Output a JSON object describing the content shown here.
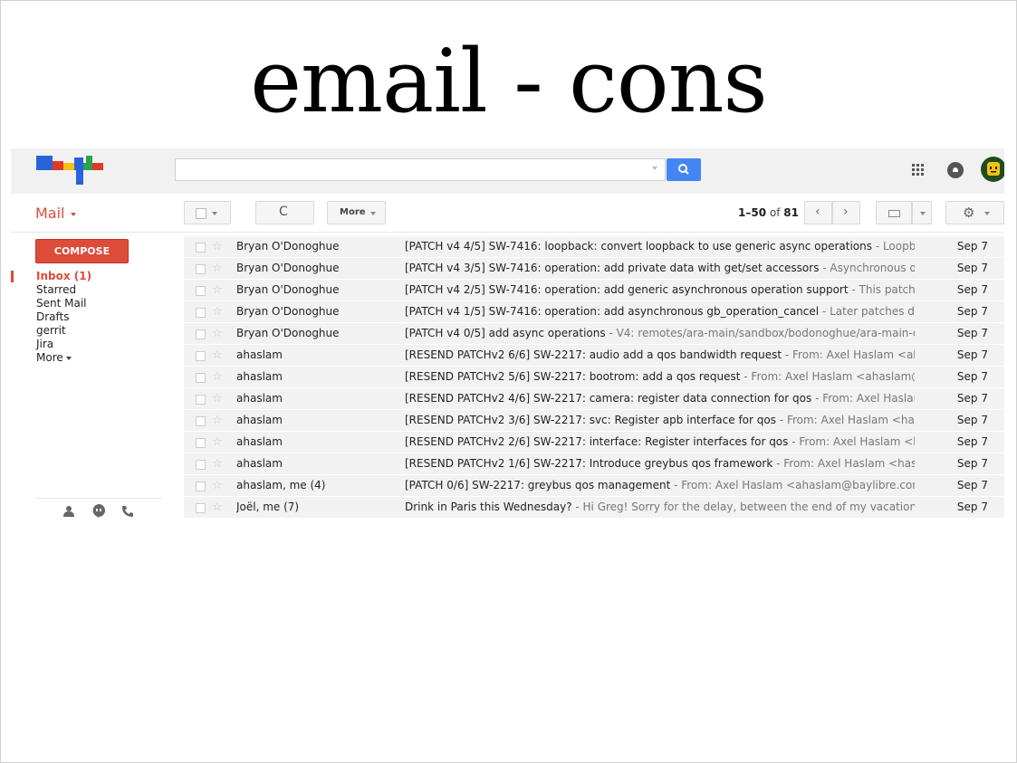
{
  "slide": {
    "title": "email - cons"
  },
  "header": {
    "search": {
      "value": "",
      "placeholder": ""
    }
  },
  "toolbar": {
    "mail_label": "Mail",
    "more_label": "More",
    "refresh_glyph": "C",
    "pager": {
      "range": "1–50",
      "of": " of ",
      "total": "81"
    }
  },
  "sidebar": {
    "compose_label": "COMPOSE",
    "items": [
      {
        "label": "Inbox (1)",
        "active": true
      },
      {
        "label": "Starred"
      },
      {
        "label": "Sent Mail"
      },
      {
        "label": "Drafts"
      },
      {
        "label": "gerrit"
      },
      {
        "label": "Jira"
      },
      {
        "label": "More"
      }
    ]
  },
  "emails": [
    {
      "sender": "Bryan O'Donoghue",
      "subject": "[PATCH v4 4/5] SW-7416: loopback: convert loopback to use generic async operations",
      "snippet": " - Loopbac",
      "date": "Sep 7"
    },
    {
      "sender": "Bryan O'Donoghue",
      "subject": "[PATCH v4 3/5] SW-7416: operation: add private data with get/set accessors",
      "snippet": " - Asynchronous ope",
      "date": "Sep 7"
    },
    {
      "sender": "Bryan O'Donoghue",
      "subject": "[PATCH v4 2/5] SW-7416: operation: add generic asynchronous operation support",
      "snippet": " - This patch ac",
      "date": "Sep 7"
    },
    {
      "sender": "Bryan O'Donoghue",
      "subject": "[PATCH v4 1/5] SW-7416: operation: add asynchronous gb_operation_cancel",
      "snippet": " - Later patches don",
      "date": "Sep 7"
    },
    {
      "sender": "Bryan O'Donoghue",
      "subject": "[PATCH v4 0/5] add async operations",
      "snippet": " - V4: remotes/ara-main/sandbox/bodonoghue/ara-main-cur",
      "date": "Sep 7"
    },
    {
      "sender": "ahaslam",
      "subject": "[RESEND PATCHv2 6/6] SW-2217: audio add a qos bandwidth request",
      "snippet": " - From: Axel Haslam <aha:",
      "date": "Sep 7"
    },
    {
      "sender": "ahaslam",
      "subject": "[RESEND PATCHv2 5/6] SW-2217: bootrom: add a qos request",
      "snippet": " - From: Axel Haslam <ahaslam@b",
      "date": "Sep 7"
    },
    {
      "sender": "ahaslam",
      "subject": "[RESEND PATCHv2 4/6] SW-2217: camera: register data connection for qos",
      "snippet": " - From: Axel Haslam",
      "date": "Sep 7"
    },
    {
      "sender": "ahaslam",
      "subject": "[RESEND PATCHv2 3/6] SW-2217: svc: Register apb interface for qos",
      "snippet": " - From: Axel Haslam <hasla",
      "date": "Sep 7"
    },
    {
      "sender": "ahaslam",
      "subject": "[RESEND PATCHv2 2/6] SW-2217: interface: Register interfaces for qos",
      "snippet": " - From: Axel Haslam <ha:",
      "date": "Sep 7"
    },
    {
      "sender": "ahaslam",
      "subject": "[RESEND PATCHv2 1/6] SW-2217: Introduce greybus qos framework",
      "snippet": " - From: Axel Haslam <haslar",
      "date": "Sep 7"
    },
    {
      "sender": "ahaslam, me (4)",
      "subject": "[PATCH 0/6] SW-2217: greybus qos management",
      "snippet": " - From: Axel Haslam <ahaslam@baylibre.com>",
      "date": "Sep 7"
    },
    {
      "sender": "Joël, me (7)",
      "subject": "Drink in Paris this Wednesday?",
      "snippet": " - Hi Greg! Sorry for the delay, between the end of my vacation ar",
      "date": "Sep 7"
    }
  ],
  "colors": {
    "accent": "#dd4b39",
    "search_button": "#4485f5"
  }
}
